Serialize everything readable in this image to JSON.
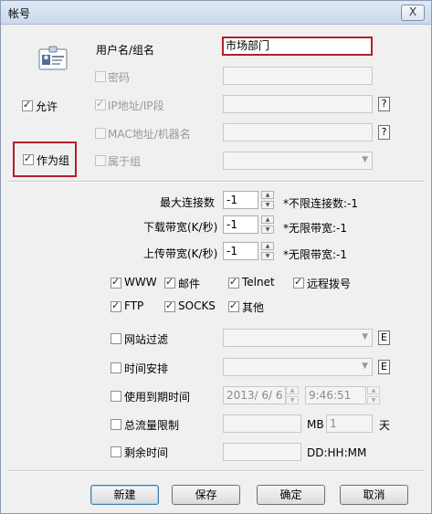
{
  "window": {
    "title": "帐号",
    "close_glyph": "X"
  },
  "account": {
    "username_label": "用户名/组名",
    "username_value": "市场部门",
    "password_label": "密码",
    "allow_label": "允许",
    "ip_label": "IP地址/IP段",
    "mac_label": "MAC地址/机器名",
    "as_group_label": "作为组",
    "belongs_group_label": "属于组",
    "help_glyph": "?"
  },
  "limits": {
    "max_conn_label": "最大连接数",
    "max_conn_value": "-1",
    "max_conn_note": "*不限连接数:-1",
    "download_label": "下载带宽(K/秒)",
    "download_value": "-1",
    "download_note": "*无限带宽:-1",
    "upload_label": "上传带宽(K/秒)",
    "upload_value": "-1",
    "upload_note": "*无限带宽:-1"
  },
  "services": [
    {
      "label": "WWW",
      "checked": true
    },
    {
      "label": "邮件",
      "checked": true
    },
    {
      "label": "Telnet",
      "checked": true
    },
    {
      "label": "远程拨号",
      "checked": true
    },
    {
      "label": "FTP",
      "checked": true
    },
    {
      "label": "SOCKS",
      "checked": true
    },
    {
      "label": "其他",
      "checked": true
    }
  ],
  "options": {
    "site_filter_label": "网站过滤",
    "schedule_label": "时间安排",
    "edit_glyph": "E",
    "expiry_label": "使用到期时间",
    "expiry_date": "2013/ 6/ 6",
    "expiry_time": "9:46:51",
    "traffic_label": "总流量限制",
    "traffic_unit": "MB",
    "traffic_days_value": "1",
    "traffic_days_unit": "天",
    "remaining_label": "剩余时间",
    "remaining_format": "DD:HH:MM"
  },
  "buttons": {
    "new": "新建",
    "save": "保存",
    "ok": "确定",
    "cancel": "取消"
  }
}
